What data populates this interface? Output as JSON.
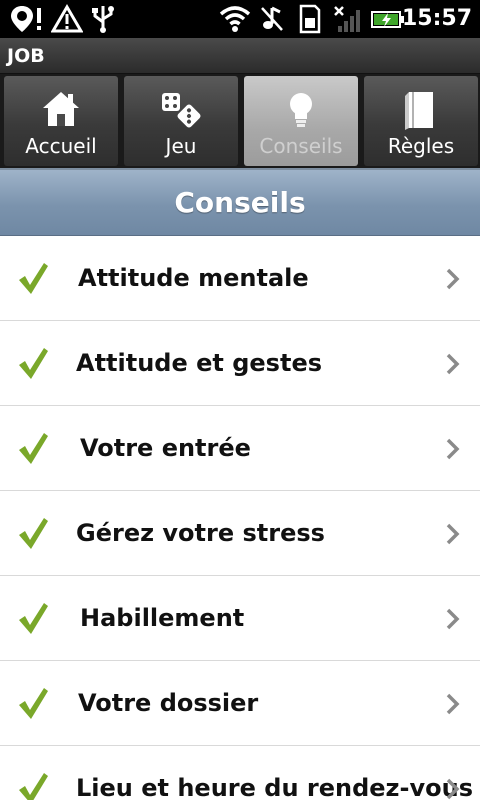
{
  "status_bar": {
    "time": "15:57",
    "icons": [
      "location-alert-icon",
      "warning-icon",
      "usb-icon",
      "wifi-icon",
      "mute-icon",
      "sd-card-icon",
      "no-signal-icon",
      "battery-charging-icon"
    ]
  },
  "app": {
    "title": "JOB"
  },
  "tabs": [
    {
      "label": "Accueil",
      "icon": "home-icon",
      "active": false
    },
    {
      "label": "Jeu",
      "icon": "dice-icon",
      "active": false
    },
    {
      "label": "Conseils",
      "icon": "lightbulb-icon",
      "active": true
    },
    {
      "label": "Règles",
      "icon": "book-icon",
      "active": false
    }
  ],
  "section": {
    "title": "Conseils"
  },
  "items": [
    {
      "label": "Attitude mentale"
    },
    {
      "label": "Attitude et gestes"
    },
    {
      "label": "Votre entrée"
    },
    {
      "label": "Gérez votre stress"
    },
    {
      "label": "Habillement"
    },
    {
      "label": "Votre dossier"
    },
    {
      "label": "Lieu et heure du rendez-vous"
    }
  ],
  "colors": {
    "check": "#7aa82a",
    "header": "#7b93ad",
    "chevron": "#8a8a8a"
  }
}
